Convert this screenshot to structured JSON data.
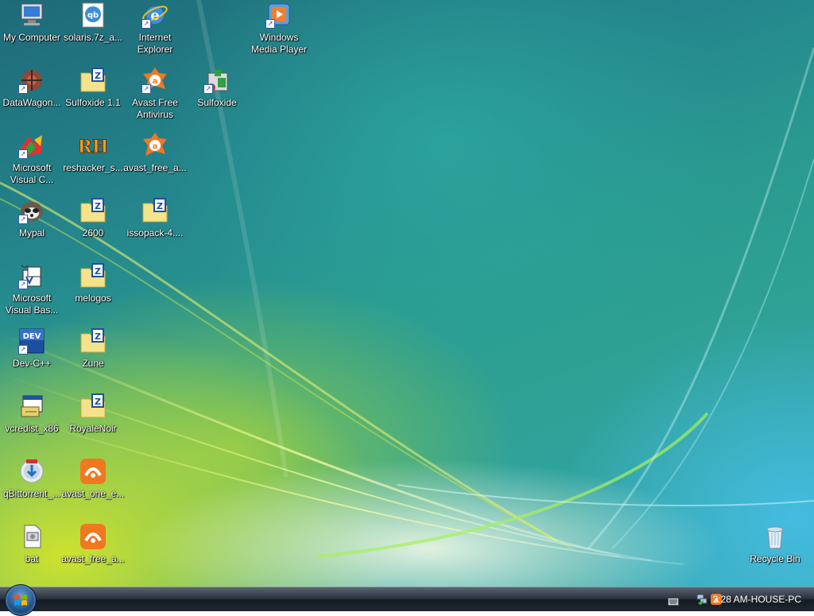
{
  "desktop": {
    "icons": [
      {
        "label": "My Computer",
        "icon": "computer-icon"
      },
      {
        "label": "solaris.7z_a...",
        "icon": "qbittorrent-file-icon"
      },
      {
        "label": "Internet\nExplorer",
        "icon": "internet-explorer-icon"
      },
      {
        "label": "Windows\nMedia Player",
        "icon": "media-player-icon"
      },
      {
        "label": "DataWagon...",
        "icon": "datawagon-icon"
      },
      {
        "label": "Sulfoxide 1.1",
        "icon": "zip-folder-icon"
      },
      {
        "label": "Avast Free\nAntivirus",
        "icon": "avast-icon"
      },
      {
        "label": "Sulfoxide",
        "icon": "sulfoxide-icon"
      },
      {
        "label": "Microsoft\nVisual C...",
        "icon": "visual-c-icon"
      },
      {
        "label": "reshacker_s...",
        "icon": "reshacker-icon"
      },
      {
        "label": "avast_free_a...",
        "icon": "avast-installer-icon"
      },
      {
        "label": "Mypal",
        "icon": "mypal-icon"
      },
      {
        "label": "2600",
        "icon": "zip-folder-icon"
      },
      {
        "label": "issopack-4....",
        "icon": "zip-folder-icon"
      },
      {
        "label": "Microsoft\nVisual Bas...",
        "icon": "visual-basic-icon"
      },
      {
        "label": "melogos",
        "icon": "zip-folder-icon"
      },
      {
        "label": "Dev-C++",
        "icon": "devcpp-icon"
      },
      {
        "label": "Zune",
        "icon": "zip-folder-icon"
      },
      {
        "label": "vcredist_x86",
        "icon": "installer-icon"
      },
      {
        "label": "RoyaleNoir",
        "icon": "zip-folder-icon"
      },
      {
        "label": "qBittorrent_...",
        "icon": "qbittorrent-installer-icon"
      },
      {
        "label": "avast_one_e...",
        "icon": "avast-one-icon"
      },
      {
        "label": "bat",
        "icon": "batch-file-icon"
      },
      {
        "label": "avast_free_a...",
        "icon": "avast-one-icon"
      },
      {
        "label": "Recycle Bin",
        "icon": "recycle-bin-icon"
      }
    ]
  },
  "taskbar": {
    "clock": "2:28 AM-HOUSE-PC",
    "start_icon": "windows-orb-icon",
    "tray_icons": [
      "keyboard-icon",
      "network-icon",
      "avast-tray-icon"
    ]
  },
  "colors": {
    "taskbar": "#1e262f",
    "avast": "#f07820",
    "folder": "#f4e38a"
  }
}
